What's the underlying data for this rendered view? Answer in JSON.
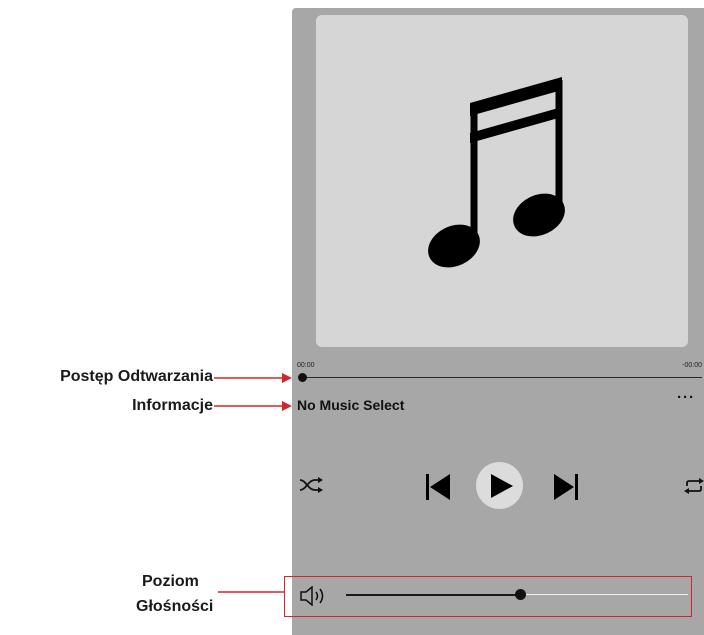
{
  "player": {
    "time_elapsed": "00:00",
    "time_remaining": "-00:00",
    "progress": 0,
    "track_title": "No Music Select",
    "more_label": "···",
    "volume": 0.51,
    "icons": {
      "artwork": "music-note-icon",
      "shuffle": "shuffle-icon",
      "previous": "skip-previous-icon",
      "play": "play-icon",
      "next": "skip-next-icon",
      "repeat": "repeat-icon",
      "volume": "speaker-icon"
    }
  },
  "annotations": {
    "progress_label": "Postęp Odtwarzania",
    "info_label": "Informacje",
    "volume_label_line1": "Poziom",
    "volume_label_line2": "Głośności"
  },
  "colors": {
    "panel": "#a7a7a7",
    "artwork_bg": "#d5d6d5",
    "annotation_red": "#d4252b"
  }
}
